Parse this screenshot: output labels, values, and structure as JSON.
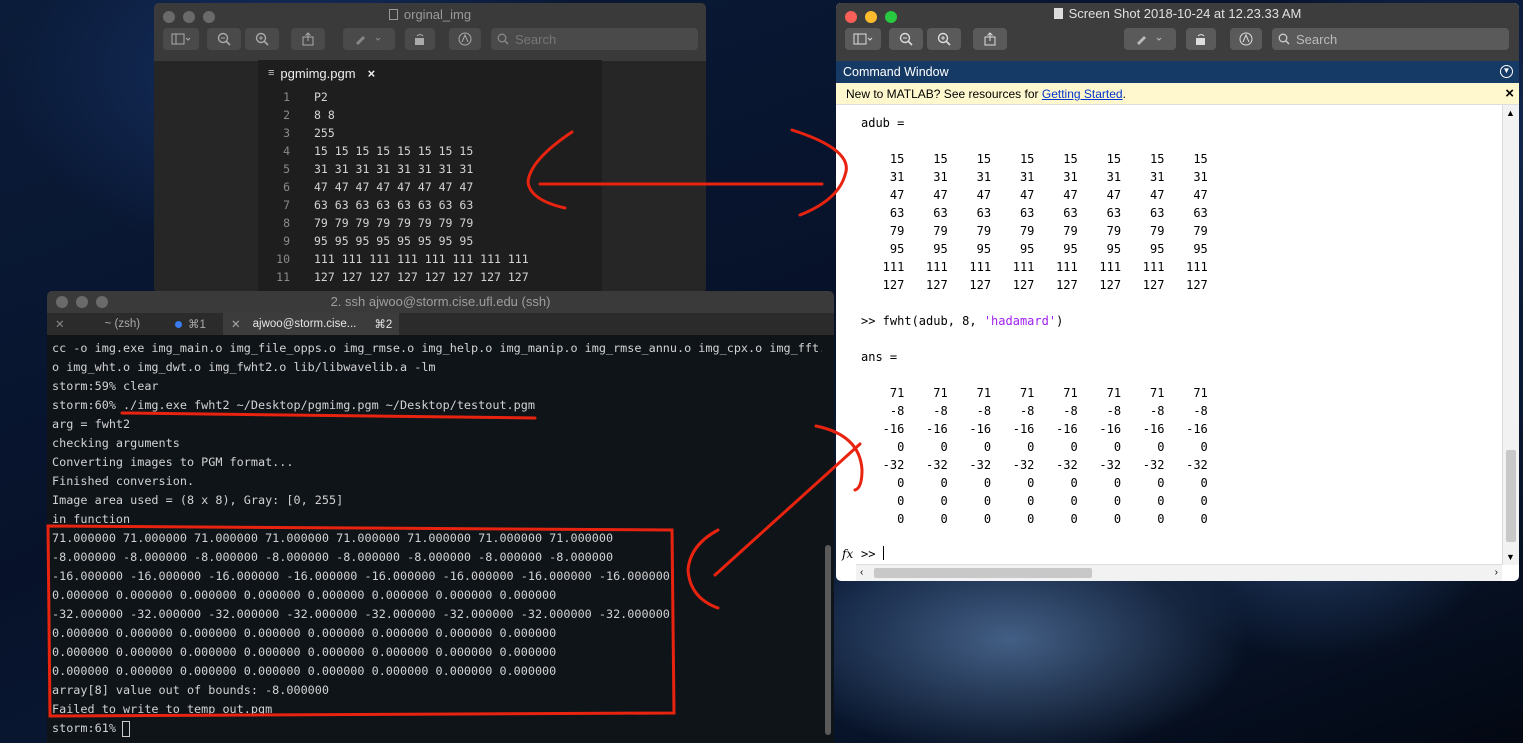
{
  "preview_left": {
    "title": "orginal_img",
    "search_placeholder": "Search",
    "editor_tab": "pgmimg.pgm",
    "close": "×",
    "lines": [
      {
        "n": "1",
        "t": "P2"
      },
      {
        "n": "2",
        "t": "8 8"
      },
      {
        "n": "3",
        "t": "255"
      },
      {
        "n": "4",
        "t": "15 15 15 15 15 15 15 15"
      },
      {
        "n": "5",
        "t": "31 31 31 31 31 31 31 31"
      },
      {
        "n": "6",
        "t": "47 47 47 47 47 47 47 47"
      },
      {
        "n": "7",
        "t": "63 63 63 63 63 63 63 63"
      },
      {
        "n": "8",
        "t": "79 79 79 79 79 79 79 79"
      },
      {
        "n": "9",
        "t": "95 95 95 95 95 95 95 95"
      },
      {
        "n": "10",
        "t": "111 111 111 111 111 111 111 111"
      },
      {
        "n": "11",
        "t": "127 127 127 127 127 127 127 127"
      }
    ]
  },
  "terminal": {
    "title": "2. ssh ajwoo@storm.cise.ufl.edu (ssh)",
    "tabs": [
      {
        "label": "~ (zsh)",
        "shortcut": "⌘1"
      },
      {
        "label": "ajwoo@storm.cise...",
        "shortcut": "⌘2"
      }
    ],
    "lines": [
      "cc -o img.exe img_main.o img_file_opps.o img_rmse.o img_help.o img_manip.o img_rmse_annu.o img_cpx.o img_fft.",
      "o img_wht.o img_dwt.o img_fwht2.o lib/libwavelib.a -lm",
      "storm:59% clear",
      "storm:60% ./img.exe fwht2 ~/Desktop/pgmimg.pgm ~/Desktop/testout.pgm",
      "arg = fwht2",
      "checking arguments",
      "Converting images to PGM format...",
      "Finished conversion.",
      "Image area used = (8 x 8), Gray: [0, 255]",
      "in function",
      "71.000000 71.000000 71.000000 71.000000 71.000000 71.000000 71.000000 71.000000",
      "-8.000000 -8.000000 -8.000000 -8.000000 -8.000000 -8.000000 -8.000000 -8.000000",
      "-16.000000 -16.000000 -16.000000 -16.000000 -16.000000 -16.000000 -16.000000 -16.000000",
      "0.000000 0.000000 0.000000 0.000000 0.000000 0.000000 0.000000 0.000000",
      "-32.000000 -32.000000 -32.000000 -32.000000 -32.000000 -32.000000 -32.000000 -32.000000",
      "0.000000 0.000000 0.000000 0.000000 0.000000 0.000000 0.000000 0.000000",
      "0.000000 0.000000 0.000000 0.000000 0.000000 0.000000 0.000000 0.000000",
      "0.000000 0.000000 0.000000 0.000000 0.000000 0.000000 0.000000 0.000000",
      "array[8] value out of bounds: -8.000000",
      "Failed to write to temp_out.pgm",
      "storm:61% "
    ]
  },
  "matlab": {
    "title": "Screen Shot 2018-10-24 at 12.23.33 AM",
    "search_placeholder": "Search",
    "command_window": "Command Window",
    "notice_prefix": "New to MATLAB? See resources for ",
    "notice_link": "Getting Started",
    "notice_suffix": ".",
    "close": "×",
    "lines": [
      "adub =",
      "",
      "    15    15    15    15    15    15    15    15",
      "    31    31    31    31    31    31    31    31",
      "    47    47    47    47    47    47    47    47",
      "    63    63    63    63    63    63    63    63",
      "    79    79    79    79    79    79    79    79",
      "    95    95    95    95    95    95    95    95",
      "   111   111   111   111   111   111   111   111",
      "   127   127   127   127   127   127   127   127",
      "",
      ">> fwht(adub, 8, ",
      "",
      "ans =",
      "",
      "    71    71    71    71    71    71    71    71",
      "    -8    -8    -8    -8    -8    -8    -8    -8",
      "   -16   -16   -16   -16   -16   -16   -16   -16",
      "     0     0     0     0     0     0     0     0",
      "   -32   -32   -32   -32   -32   -32   -32   -32",
      "     0     0     0     0     0     0     0     0",
      "     0     0     0     0     0     0     0     0",
      "     0     0     0     0     0     0     0     0"
    ],
    "cmd_string": "'hadamard'",
    "cmd_suffix": ")",
    "prompt_fx": "fx",
    "prompt": ">>"
  },
  "colors": {
    "annotation": "#e8230f",
    "close_red": "#fc5f57",
    "min_yellow": "#fdbc2e",
    "max_green": "#28c840"
  }
}
